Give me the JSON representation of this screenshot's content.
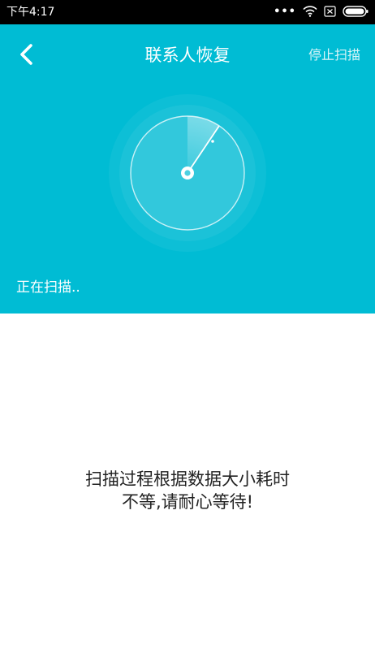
{
  "status_bar": {
    "time": "下午4:17",
    "icons": [
      "dots-icon",
      "wifi-icon",
      "sim-icon",
      "battery-icon"
    ]
  },
  "header": {
    "title": "联系人恢复",
    "back_icon": "back-arrow-icon",
    "stop_label": "停止扫描"
  },
  "scan": {
    "status_text": "正在扫描..",
    "radar_icon": "radar-icon"
  },
  "message": {
    "line1": "扫描过程根据数据大小耗时",
    "line2": "不等,请耐心等待!"
  },
  "colors": {
    "accent": "#00bcd4",
    "status_bar": "#000000",
    "text_dark": "#222222",
    "background": "#ffffff"
  }
}
